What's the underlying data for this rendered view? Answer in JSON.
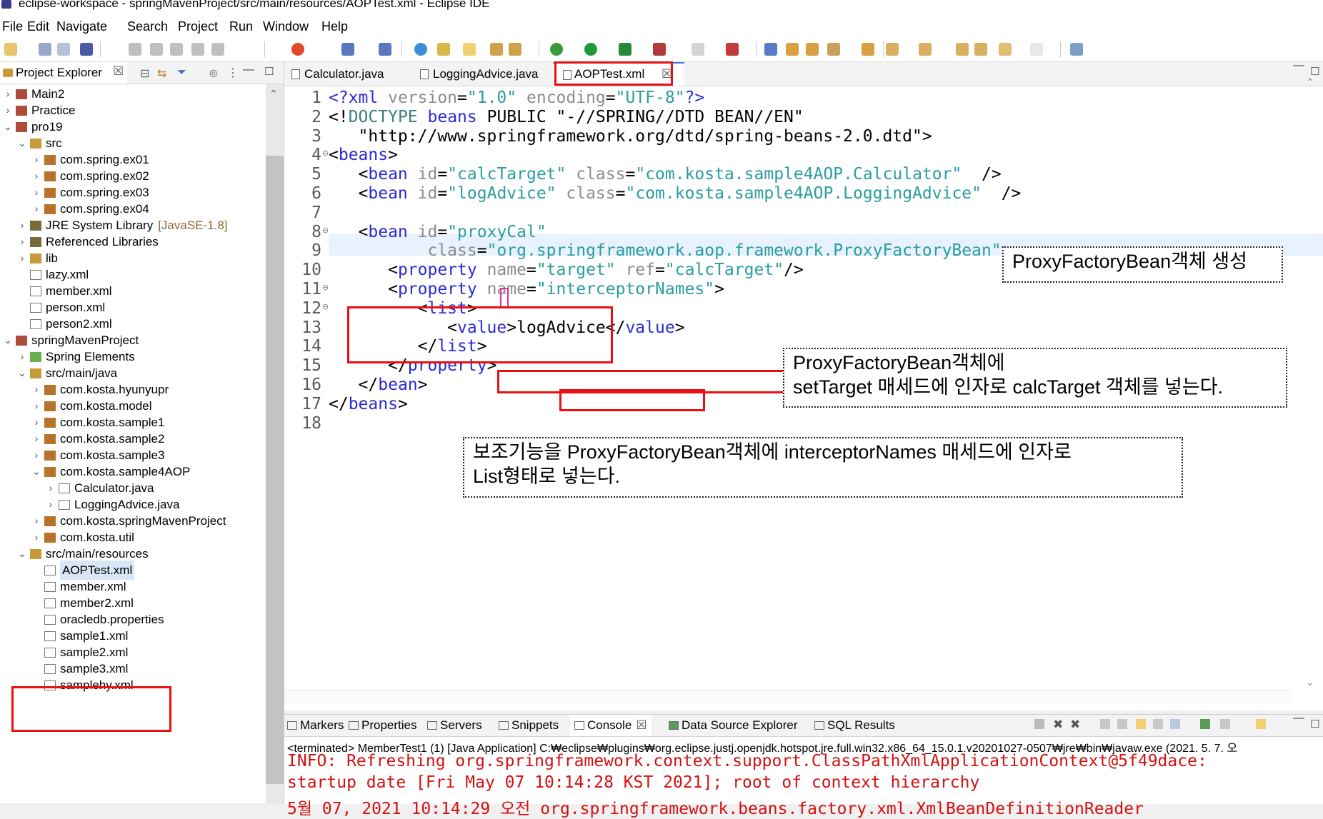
{
  "window": {
    "title": "eclipse-workspace - springMavenProject/src/main/resources/AOPTest.xml - Eclipse IDE"
  },
  "menu": [
    "File",
    "Edit",
    "Navigate",
    "Search",
    "Project",
    "Run",
    "Window",
    "Help"
  ],
  "explorer": {
    "title": "Project Explorer",
    "items": [
      {
        "label": "Main2",
        "indent": 0,
        "twisty": ">",
        "icon": "project-icon"
      },
      {
        "label": "Practice",
        "indent": 0,
        "twisty": ">",
        "icon": "project-icon"
      },
      {
        "label": "pro19",
        "indent": 0,
        "twisty": "v",
        "icon": "project-icon"
      },
      {
        "label": "src",
        "indent": 1,
        "twisty": "v",
        "icon": "source-folder-icon"
      },
      {
        "label": "com.spring.ex01",
        "indent": 2,
        "twisty": ">",
        "icon": "package-icon"
      },
      {
        "label": "com.spring.ex02",
        "indent": 2,
        "twisty": ">",
        "icon": "package-icon"
      },
      {
        "label": "com.spring.ex03",
        "indent": 2,
        "twisty": ">",
        "icon": "package-icon"
      },
      {
        "label": "com.spring.ex04",
        "indent": 2,
        "twisty": ">",
        "icon": "package-icon"
      },
      {
        "label": "JRE System Library",
        "indent": 1,
        "twisty": ">",
        "icon": "library-icon",
        "decoration": "[JavaSE-1.8]"
      },
      {
        "label": "Referenced Libraries",
        "indent": 1,
        "twisty": ">",
        "icon": "library-icon"
      },
      {
        "label": "lib",
        "indent": 1,
        "twisty": ">",
        "icon": "folder-icon"
      },
      {
        "label": "lazy.xml",
        "indent": 1,
        "twisty": "",
        "icon": "xml-file-icon"
      },
      {
        "label": "member.xml",
        "indent": 1,
        "twisty": "",
        "icon": "xml-file-icon"
      },
      {
        "label": "person.xml",
        "indent": 1,
        "twisty": "",
        "icon": "xml-file-icon"
      },
      {
        "label": "person2.xml",
        "indent": 1,
        "twisty": "",
        "icon": "xml-file-icon"
      },
      {
        "label": "springMavenProject",
        "indent": 0,
        "twisty": "v",
        "icon": "project-icon"
      },
      {
        "label": "Spring Elements",
        "indent": 1,
        "twisty": ">",
        "icon": "spring-leaf-icon"
      },
      {
        "label": "src/main/java",
        "indent": 1,
        "twisty": "v",
        "icon": "source-folder-icon"
      },
      {
        "label": "com.kosta.hyunyupr",
        "indent": 2,
        "twisty": ">",
        "icon": "package-icon"
      },
      {
        "label": "com.kosta.model",
        "indent": 2,
        "twisty": ">",
        "icon": "package-icon"
      },
      {
        "label": "com.kosta.sample1",
        "indent": 2,
        "twisty": ">",
        "icon": "package-icon"
      },
      {
        "label": "com.kosta.sample2",
        "indent": 2,
        "twisty": ">",
        "icon": "package-icon"
      },
      {
        "label": "com.kosta.sample3",
        "indent": 2,
        "twisty": ">",
        "icon": "package-icon"
      },
      {
        "label": "com.kosta.sample4AOP",
        "indent": 2,
        "twisty": "v",
        "icon": "package-icon"
      },
      {
        "label": "Calculator.java",
        "indent": 3,
        "twisty": ">",
        "icon": "java-file-icon"
      },
      {
        "label": "LoggingAdvice.java",
        "indent": 3,
        "twisty": ">",
        "icon": "java-file-icon"
      },
      {
        "label": "com.kosta.springMavenProject",
        "indent": 2,
        "twisty": ">",
        "icon": "package-icon"
      },
      {
        "label": "com.kosta.util",
        "indent": 2,
        "twisty": ">",
        "icon": "package-icon"
      },
      {
        "label": "src/main/resources",
        "indent": 1,
        "twisty": "v",
        "icon": "source-folder-icon"
      },
      {
        "label": "AOPTest.xml",
        "indent": 2,
        "twisty": "",
        "icon": "xml-file-icon",
        "selected": true
      },
      {
        "label": "member.xml",
        "indent": 2,
        "twisty": "",
        "icon": "xml-file-icon"
      },
      {
        "label": "member2.xml",
        "indent": 2,
        "twisty": "",
        "icon": "xml-file-icon"
      },
      {
        "label": "oracledb.properties",
        "indent": 2,
        "twisty": "",
        "icon": "properties-file-icon"
      },
      {
        "label": "sample1.xml",
        "indent": 2,
        "twisty": "",
        "icon": "spring-xml-icon"
      },
      {
        "label": "sample2.xml",
        "indent": 2,
        "twisty": "",
        "icon": "spring-xml-icon"
      },
      {
        "label": "sample3.xml",
        "indent": 2,
        "twisty": "",
        "icon": "spring-xml-icon"
      },
      {
        "label": "samplehy.xml",
        "indent": 2,
        "twisty": "",
        "icon": "spring-xml-icon"
      }
    ]
  },
  "editor": {
    "tabs": [
      {
        "label": "Calculator.java",
        "icon": "java-file-icon"
      },
      {
        "label": "LoggingAdvice.java",
        "icon": "java-file-icon"
      },
      {
        "label": "AOPTest.xml",
        "icon": "xml-file-icon",
        "active": true
      }
    ],
    "lines": [
      {
        "n": "1",
        "fold": "",
        "parts": [
          [
            "t",
            "<?xml "
          ],
          [
            "a",
            "version"
          ],
          [
            "b",
            "="
          ],
          [
            "s",
            "\"1.0\""
          ],
          [
            "b",
            " "
          ],
          [
            "a",
            "encoding"
          ],
          [
            "b",
            "="
          ],
          [
            "s",
            "\"UTF-8\""
          ],
          [
            "t",
            "?>"
          ]
        ]
      },
      {
        "n": "2",
        "fold": "",
        "parts": [
          [
            "b",
            "<!"
          ],
          [
            "p",
            "DOCTYPE"
          ],
          [
            "b",
            " "
          ],
          [
            "t",
            "beans"
          ],
          [
            "b",
            " PUBLIC \"-//SPRING//DTD BEAN//EN\""
          ]
        ]
      },
      {
        "n": "3",
        "fold": "",
        "parts": [
          [
            "b",
            "   \"http://www.springframework.org/dtd/spring-beans-2.0.dtd\">"
          ]
        ]
      },
      {
        "n": "4",
        "fold": "⊖",
        "parts": [
          [
            "b",
            "<"
          ],
          [
            "t",
            "beans"
          ],
          [
            "b",
            ">"
          ]
        ]
      },
      {
        "n": "5",
        "fold": "",
        "parts": [
          [
            "b",
            "   <"
          ],
          [
            "t",
            "bean"
          ],
          [
            "b",
            " "
          ],
          [
            "a",
            "id"
          ],
          [
            "b",
            "="
          ],
          [
            "s",
            "\"calcTarget\""
          ],
          [
            "b",
            " "
          ],
          [
            "a",
            "class"
          ],
          [
            "b",
            "="
          ],
          [
            "s",
            "\"com.kosta.sample4AOP.Calculator\""
          ],
          [
            "b",
            "  />"
          ]
        ]
      },
      {
        "n": "6",
        "fold": "",
        "parts": [
          [
            "b",
            "   <"
          ],
          [
            "t",
            "bean"
          ],
          [
            "b",
            " "
          ],
          [
            "a",
            "id"
          ],
          [
            "b",
            "="
          ],
          [
            "s",
            "\"logAdvice\""
          ],
          [
            "b",
            " "
          ],
          [
            "a",
            "class"
          ],
          [
            "b",
            "="
          ],
          [
            "s",
            "\"com.kosta.sample4AOP.LoggingAdvice\""
          ],
          [
            "b",
            "  />"
          ]
        ]
      },
      {
        "n": "7",
        "fold": "",
        "parts": []
      },
      {
        "n": "8",
        "fold": "⊖",
        "parts": [
          [
            "b",
            "   <"
          ],
          [
            "t",
            "bean"
          ],
          [
            "b",
            " "
          ],
          [
            "a",
            "id"
          ],
          [
            "b",
            "="
          ],
          [
            "s",
            "\"proxyCal\""
          ]
        ]
      },
      {
        "n": "9",
        "fold": "",
        "parts": [
          [
            "b",
            "          "
          ],
          [
            "a",
            "class"
          ],
          [
            "b",
            "="
          ],
          [
            "s",
            "\"org.springframework.aop.framework.ProxyFactoryBean\""
          ],
          [
            "b",
            ">"
          ]
        ]
      },
      {
        "n": "10",
        "fold": "",
        "parts": [
          [
            "b",
            "      <"
          ],
          [
            "t",
            "property"
          ],
          [
            "b",
            " "
          ],
          [
            "a",
            "name"
          ],
          [
            "b",
            "="
          ],
          [
            "s",
            "\"target\""
          ],
          [
            "b",
            " "
          ],
          [
            "a",
            "ref"
          ],
          [
            "b",
            "="
          ],
          [
            "s",
            "\"calcTarget\""
          ],
          [
            "b",
            "/>"
          ]
        ]
      },
      {
        "n": "11",
        "fold": "⊖",
        "parts": [
          [
            "b",
            "      <"
          ],
          [
            "t",
            "property"
          ],
          [
            "b",
            " "
          ],
          [
            "a",
            "name"
          ],
          [
            "b",
            "="
          ],
          [
            "s",
            "\"interceptorNames\""
          ],
          [
            "b",
            ">"
          ]
        ]
      },
      {
        "n": "12",
        "fold": "⊖",
        "parts": [
          [
            "b",
            "         <"
          ],
          [
            "t",
            "list"
          ],
          [
            "b",
            ">"
          ]
        ]
      },
      {
        "n": "13",
        "fold": "",
        "parts": [
          [
            "b",
            "            <"
          ],
          [
            "t",
            "value"
          ],
          [
            "b",
            ">logAdvice</"
          ],
          [
            "t",
            "value"
          ],
          [
            "b",
            ">"
          ]
        ]
      },
      {
        "n": "14",
        "fold": "",
        "parts": [
          [
            "b",
            "         </"
          ],
          [
            "t",
            "list"
          ],
          [
            "b",
            ">"
          ]
        ]
      },
      {
        "n": "15",
        "fold": "",
        "parts": [
          [
            "b",
            "      </"
          ],
          [
            "t",
            "property"
          ],
          [
            "b",
            ">"
          ]
        ]
      },
      {
        "n": "16",
        "fold": "",
        "parts": [
          [
            "b",
            "   </"
          ],
          [
            "t",
            "bean"
          ],
          [
            "b",
            ">"
          ]
        ]
      },
      {
        "n": "17",
        "fold": "",
        "parts": [
          [
            "b",
            "</"
          ],
          [
            "t",
            "beans"
          ],
          [
            "b",
            ">"
          ]
        ]
      },
      {
        "n": "18",
        "fold": "",
        "parts": []
      }
    ]
  },
  "annotations": {
    "note1": "ProxyFactoryBean객체 생성",
    "note2_line1": "ProxyFactoryBean객체에",
    "note2_line2": "setTarget 매세드에 인자로 calcTarget 객체를 넣는다.",
    "note3_line1": "보조기능을 ProxyFactoryBean객체에 interceptorNames 매세드에 인자로",
    "note3_line2": "List형태로 넣는다."
  },
  "console": {
    "tabs": [
      "Markers",
      "Properties",
      "Servers",
      "Snippets",
      "Console",
      "Data Source Explorer",
      "SQL Results"
    ],
    "active_tab": "Console",
    "description": "<terminated> MemberTest1 (1) [Java Application] C:₩eclipse₩plugins₩org.eclipse.justj.openjdk.hotspot.jre.full.win32.x86_64_15.0.1.v20201027-0507₩jre₩bin₩javaw.exe  (2021. 5. 7. 오",
    "lines": [
      "INFO: Refreshing org.springframework.context.support.ClassPathXmlApplicationContext@5f49dace:",
      "startup date [Fri May 07 10:14:28 KST 2021]; root of context hierarchy",
      "5월 07, 2021 10:14:29 오전 org.springframework.beans.factory.xml.XmlBeanDefinitionReader"
    ]
  },
  "colors": {
    "tag": "#2b2bd6",
    "attr": "#8c8c8c",
    "string": "#2a9d9d",
    "highlight": "#e81010",
    "console_text": "#d41010"
  }
}
